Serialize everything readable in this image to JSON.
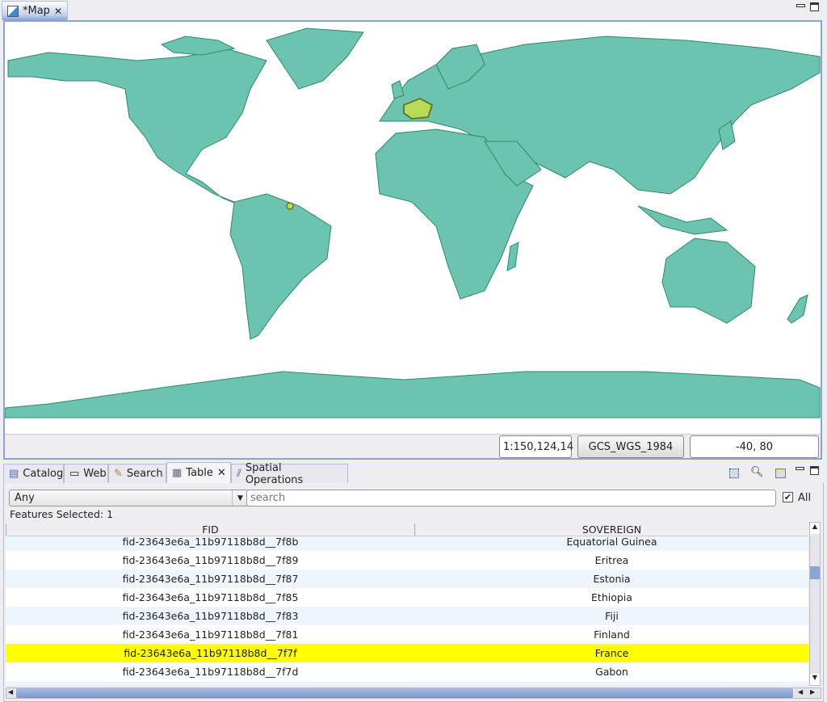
{
  "editor_tab": {
    "label": "*Map",
    "icon": "map-icon"
  },
  "map": {
    "land_color": "#6cc4b0",
    "border_color": "#2a8a6a",
    "selected_color": "#b8dc5a",
    "selected_feature": "France"
  },
  "status_bar": {
    "scale": "1:150,124,14",
    "crs": "GCS_WGS_1984",
    "coords": "-40, 80"
  },
  "views": [
    {
      "label": "Catalog",
      "icon": "catalog-icon"
    },
    {
      "label": "Web",
      "icon": "web-icon"
    },
    {
      "label": "Search",
      "icon": "search-icon"
    },
    {
      "label": "Table",
      "icon": "table-icon"
    },
    {
      "label": "Spatial Operations",
      "icon": "spatial-ops-icon"
    }
  ],
  "table": {
    "filter": "Any",
    "search_placeholder": "search",
    "all_label": "All",
    "all_checked": true,
    "features_selected": "Features Selected: 1",
    "columns": [
      "FID",
      "SOVEREIGN"
    ],
    "rows": [
      {
        "fid": "fid-23643e6a_11b97118b8d__7f8b",
        "sov": "Equatorial Guinea"
      },
      {
        "fid": "fid-23643e6a_11b97118b8d__7f89",
        "sov": "Eritrea"
      },
      {
        "fid": "fid-23643e6a_11b97118b8d__7f87",
        "sov": "Estonia"
      },
      {
        "fid": "fid-23643e6a_11b97118b8d__7f85",
        "sov": "Ethiopia"
      },
      {
        "fid": "fid-23643e6a_11b97118b8d__7f83",
        "sov": "Fiji"
      },
      {
        "fid": "fid-23643e6a_11b97118b8d__7f81",
        "sov": "Finland"
      },
      {
        "fid": "fid-23643e6a_11b97118b8d__7f7f",
        "sov": "France",
        "selected": true
      },
      {
        "fid": "fid-23643e6a_11b97118b8d__7f7d",
        "sov": "Gabon"
      },
      {
        "fid": "",
        "sov": ""
      }
    ]
  }
}
